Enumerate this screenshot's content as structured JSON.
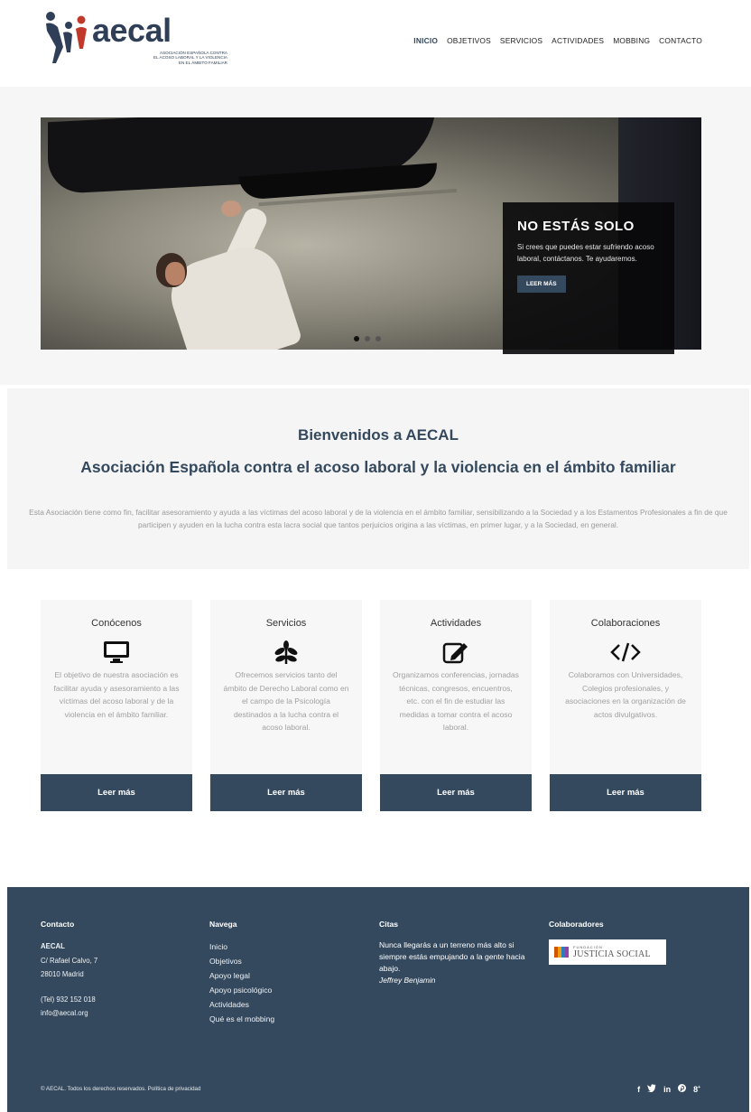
{
  "header": {
    "logo_word": "aecal",
    "logo_tag_lines": [
      "ASOCIACIÓN ESPAÑOLA CONTRA",
      "EL ACOSO LABORAL Y LA VIOLENCIA",
      "EN EL ÁMBITO FAMILIAR"
    ],
    "nav": [
      "INICIO",
      "OBJETIVOS",
      "SERVICIOS",
      "ACTIVIDADES",
      "MOBBING",
      "CONTACTO"
    ],
    "active_nav": "INICIO"
  },
  "slider": {
    "title": "NO ESTÁS SOLO",
    "text": "Si crees que puedes estar sufriendo acoso laboral, contáctanos. Te ayudaremos.",
    "button": "LEER MÁS",
    "dots": 3,
    "active_dot": 1
  },
  "welcome": {
    "title": "Bienvenidos a AECAL",
    "subtitle": "Asociación Española contra el acoso laboral y la violencia en el ámbito familiar",
    "text": "Esta Asociación tiene como fin, facilitar asesoramiento y ayuda a las víctimas del acoso laboral y de la violencia en el ámbito familiar, sensibilizando a la Sociedad y a los Estamentos Profesionales a fin de que participen y ayuden en la lucha contra esta lacra social que tantos perjuicios origina a las víctimas, en primer lugar, y a la Sociedad, en general."
  },
  "cards": [
    {
      "title": "Conócenos",
      "icon": "monitor-icon",
      "text": "El objetivo de nuestra asociación es facilitar ayuda y asesoramiento a las víctimas del acoso laboral y de la violencia en el ámbito familiar.",
      "button": "Leer más"
    },
    {
      "title": "Servicios",
      "icon": "leaf-icon",
      "text": "Ofrecemos servicios tanto del ámbito de Derecho Laboral como en el campo de la Psicología destinados a la lucha contra el acoso laboral.",
      "button": "Leer más"
    },
    {
      "title": "Actividades",
      "icon": "edit-icon",
      "text": "Organizamos conferencias, jornadas técnicas, congresos, encuentros, etc. con el fin de estudiar las medidas a tomar contra el acoso laboral.",
      "button": "Leer más"
    },
    {
      "title": "Colaboraciones",
      "icon": "code-icon",
      "text": "Colaboramos con Universidades, Colegios profesionales, y asociaciones en la organización de actos divulgativos.",
      "button": "Leer más"
    }
  ],
  "footer": {
    "contact": {
      "heading": "Contacto",
      "name": "AECAL",
      "address1": "C/ Rafael Calvo, 7",
      "address2": "28010 Madrid",
      "phone": "(Tel) 932 152 018",
      "email": "info@aecal.org"
    },
    "navega": {
      "heading": "Navega",
      "items": [
        "Inicio",
        "Objetivos",
        "Apoyo legal",
        "Apoyo psicológico",
        "Actividades",
        "Qué es el mobbing"
      ]
    },
    "citas": {
      "heading": "Citas",
      "quote": "Nunca llegarás a un terreno más alto si siempre estás empujando a la gente hacia abajo.",
      "author": "Jeffrey Benjamin"
    },
    "colaboradores": {
      "heading": "Colaboradores",
      "logo_small": "FUNDACIÓN",
      "logo_big": "JUSTICIA SOCIAL"
    },
    "copyright": "© AECAL. Todos los derechos reservados. Política de privacidad",
    "social": [
      "facebook-icon",
      "twitter-icon",
      "linkedin-icon",
      "pinterest-icon",
      "google-plus-icon"
    ]
  },
  "colors": {
    "primary": "#34495e",
    "caption_bg": "#08080a",
    "card_bg": "#f7f7f7",
    "welcome_bg": "#f5f5f5"
  }
}
